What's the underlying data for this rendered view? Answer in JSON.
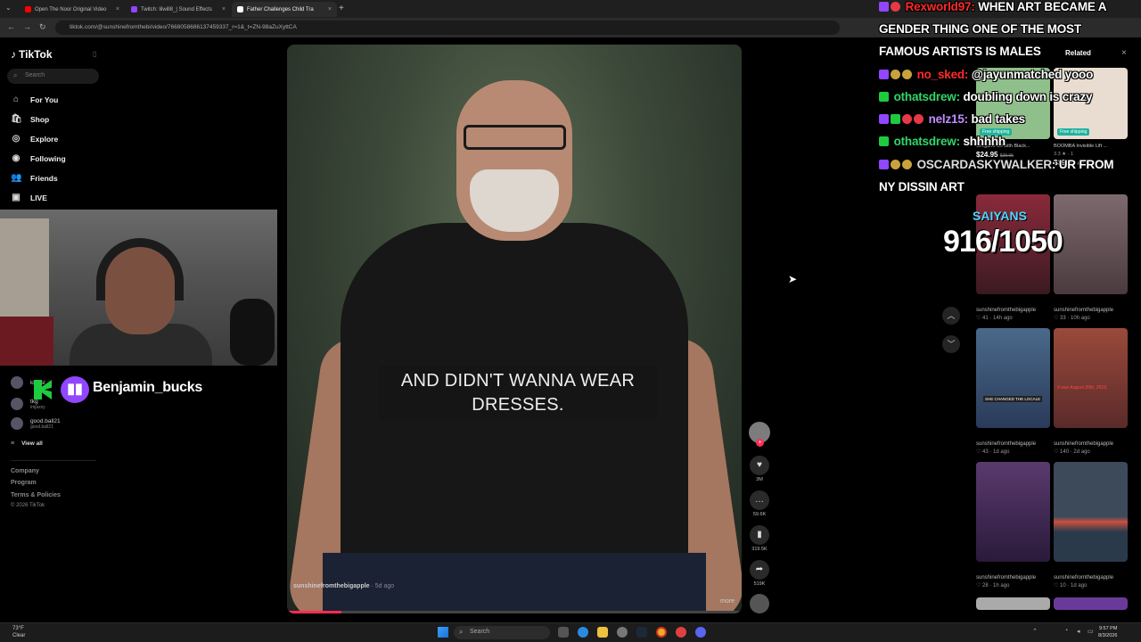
{
  "browser": {
    "tabs": [
      {
        "label": "Open The Noor Original Video",
        "color": "#ff0000"
      },
      {
        "label": "Twitch: lilwill8_| Sound Effects",
        "color": "#9146ff"
      },
      {
        "label": "Father Challenges Child Tra",
        "color": "#ffffff"
      }
    ],
    "new_tab": "+",
    "url": "tiktok.com/@sunshinefromthebi/video/7668058686137459337_r=1&_t=ZN-98aZuXyttCA"
  },
  "tiktok": {
    "logo": "TikTok",
    "search_placeholder": "Search",
    "nav": [
      {
        "label": "For You",
        "icon": "home-icon",
        "glyph": "⌂"
      },
      {
        "label": "Shop",
        "icon": "shop-icon",
        "glyph": "🛍"
      },
      {
        "label": "Explore",
        "icon": "explore-icon",
        "glyph": "◎"
      },
      {
        "label": "Following",
        "icon": "following-icon",
        "glyph": "◉"
      },
      {
        "label": "Friends",
        "icon": "friends-icon",
        "glyph": "👥"
      },
      {
        "label": "LIVE",
        "icon": "live-icon",
        "glyph": "▣"
      }
    ],
    "following": [
      {
        "name": "kingsl",
        "sub": ""
      },
      {
        "name": "tkg",
        "sub": "imjaxxy"
      },
      {
        "name": "good.ball21",
        "sub": "good.ball21"
      }
    ],
    "view_all": "View all",
    "footer": [
      "Company",
      "Program",
      "Terms & Policies",
      "© 2026 TikTok"
    ]
  },
  "overlay": {
    "streamer_name": "Benjamin_bucks",
    "k_badge": "K",
    "twitch_glyph": "▮▮",
    "counter_label": "SAIYANS",
    "counter_value": "916/1050"
  },
  "video": {
    "caption_line1": "AND DIDN'T WANNA WEAR",
    "caption_line2": "DRESSES.",
    "author": "sunshinefromthebigapple",
    "author_time": "· 5d ago",
    "more": "more",
    "progress": 0.12,
    "actions": [
      {
        "name": "like",
        "glyph": "♥",
        "count": "3M"
      },
      {
        "name": "comment",
        "glyph": "…",
        "count": "59.6K"
      },
      {
        "name": "save",
        "glyph": "▮",
        "count": "319.5K"
      },
      {
        "name": "share",
        "glyph": "➦",
        "count": "519K"
      }
    ]
  },
  "related": {
    "tab": "Related",
    "close": "×",
    "products": [
      {
        "title": "Oregano Oil with Black...",
        "label": "Free shipping",
        "price": "$24.95",
        "old": "$38.95",
        "color": "#8fbf8a"
      },
      {
        "title": "BOOMBA Invisible Lift ...",
        "label": "Free shipping",
        "price": "$39.99",
        "old": "$55.00",
        "rating": "3.3 ★ · 1",
        "color": "#e8ddd0"
      }
    ],
    "videos": [
      {
        "author": "sunshinefromthebigapple",
        "stats": "♡ 41 · 14h ago",
        "color": "#7a2a3a"
      },
      {
        "author": "sunshinefromthebigapple",
        "stats": "♡ 33 · 10h ago",
        "color": "#6d5a5e"
      },
      {
        "author": "sunshinefromthebigapple",
        "stats": "♡ 43 · 1d ago",
        "color": "#3a5a7a"
      },
      {
        "author": "sunshinefromthebigapple",
        "stats": "♡ 140 · 2d ago",
        "color": "#8a3a30"
      },
      {
        "author": "sunshinefromthebigapple",
        "stats": "♡ 28 · 1h ago",
        "color": "#5a3a5e"
      },
      {
        "author": "sunshinefromthebigapple",
        "stats": "♡ 10 · 1d ago",
        "color": "#3c4a5a"
      }
    ],
    "thumb_texts": [
      "SHE CHANGED THE LOCALE",
      "It was August 20th, 2019,"
    ]
  },
  "chat": [
    {
      "user": "Rexworld97:",
      "user_color": "red",
      "badges": [
        "purple",
        "red"
      ],
      "text": "WHEN ART BECAME A"
    },
    {
      "user": "",
      "user_color": "gray",
      "badges": [],
      "text": "GENDER THING ONE OF THE MOST"
    },
    {
      "user": "",
      "user_color": "gray",
      "badges": [],
      "text": "FAMOUS ARTISTS IS MALES"
    },
    {
      "user": "no_sked:",
      "user_color": "red",
      "badges": [
        "purple",
        "gold",
        "gold"
      ],
      "text": "@jayunmatched yooo"
    },
    {
      "user": "othatsdrew:",
      "user_color": "green",
      "badges": [
        "green"
      ],
      "text": "doubling down is crazy"
    },
    {
      "user": "nelz15:",
      "user_color": "purple",
      "badges": [
        "purple",
        "green",
        "red",
        "red"
      ],
      "text": "bad takes"
    },
    {
      "user": "othatsdrew:",
      "user_color": "green",
      "badges": [
        "green"
      ],
      "text": "shhhhh"
    },
    {
      "user": "OSCARDASKYWALKER:",
      "user_color": "gray",
      "badges": [
        "purple",
        "gold",
        "gold"
      ],
      "text": "UR FROM"
    },
    {
      "user": "",
      "user_color": "gray",
      "badges": [],
      "text": "NY DISSIN ART"
    }
  ],
  "taskbar": {
    "weather_temp": "73°F",
    "weather_desc": "Clear",
    "search": "Search",
    "time": "9:57 PM",
    "date": "8/3/2026"
  }
}
